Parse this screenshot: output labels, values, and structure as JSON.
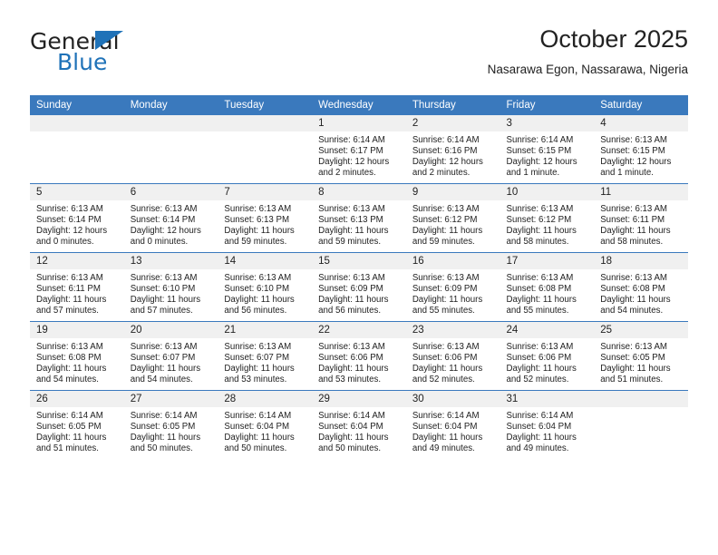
{
  "brand": {
    "name_part1": "General",
    "name_part2": "Blue",
    "triangle_icon": "triangle-icon",
    "accent_color": "#1f72b8"
  },
  "header": {
    "title": "October 2025",
    "subtitle": "Nasarawa Egon, Nassarawa, Nigeria"
  },
  "colors": {
    "header_blue": "#3a79bd",
    "daynum_band": "#f0f0f0",
    "text": "#222222"
  },
  "calendar": {
    "weekday_headers": [
      "Sunday",
      "Monday",
      "Tuesday",
      "Wednesday",
      "Thursday",
      "Friday",
      "Saturday"
    ],
    "weeks": [
      [
        {
          "day": "",
          "lines": []
        },
        {
          "day": "",
          "lines": []
        },
        {
          "day": "",
          "lines": []
        },
        {
          "day": "1",
          "lines": [
            "Sunrise: 6:14 AM",
            "Sunset: 6:17 PM",
            "Daylight: 12 hours",
            "and 2 minutes."
          ]
        },
        {
          "day": "2",
          "lines": [
            "Sunrise: 6:14 AM",
            "Sunset: 6:16 PM",
            "Daylight: 12 hours",
            "and 2 minutes."
          ]
        },
        {
          "day": "3",
          "lines": [
            "Sunrise: 6:14 AM",
            "Sunset: 6:15 PM",
            "Daylight: 12 hours",
            "and 1 minute."
          ]
        },
        {
          "day": "4",
          "lines": [
            "Sunrise: 6:13 AM",
            "Sunset: 6:15 PM",
            "Daylight: 12 hours",
            "and 1 minute."
          ]
        }
      ],
      [
        {
          "day": "5",
          "lines": [
            "Sunrise: 6:13 AM",
            "Sunset: 6:14 PM",
            "Daylight: 12 hours",
            "and 0 minutes."
          ]
        },
        {
          "day": "6",
          "lines": [
            "Sunrise: 6:13 AM",
            "Sunset: 6:14 PM",
            "Daylight: 12 hours",
            "and 0 minutes."
          ]
        },
        {
          "day": "7",
          "lines": [
            "Sunrise: 6:13 AM",
            "Sunset: 6:13 PM",
            "Daylight: 11 hours",
            "and 59 minutes."
          ]
        },
        {
          "day": "8",
          "lines": [
            "Sunrise: 6:13 AM",
            "Sunset: 6:13 PM",
            "Daylight: 11 hours",
            "and 59 minutes."
          ]
        },
        {
          "day": "9",
          "lines": [
            "Sunrise: 6:13 AM",
            "Sunset: 6:12 PM",
            "Daylight: 11 hours",
            "and 59 minutes."
          ]
        },
        {
          "day": "10",
          "lines": [
            "Sunrise: 6:13 AM",
            "Sunset: 6:12 PM",
            "Daylight: 11 hours",
            "and 58 minutes."
          ]
        },
        {
          "day": "11",
          "lines": [
            "Sunrise: 6:13 AM",
            "Sunset: 6:11 PM",
            "Daylight: 11 hours",
            "and 58 minutes."
          ]
        }
      ],
      [
        {
          "day": "12",
          "lines": [
            "Sunrise: 6:13 AM",
            "Sunset: 6:11 PM",
            "Daylight: 11 hours",
            "and 57 minutes."
          ]
        },
        {
          "day": "13",
          "lines": [
            "Sunrise: 6:13 AM",
            "Sunset: 6:10 PM",
            "Daylight: 11 hours",
            "and 57 minutes."
          ]
        },
        {
          "day": "14",
          "lines": [
            "Sunrise: 6:13 AM",
            "Sunset: 6:10 PM",
            "Daylight: 11 hours",
            "and 56 minutes."
          ]
        },
        {
          "day": "15",
          "lines": [
            "Sunrise: 6:13 AM",
            "Sunset: 6:09 PM",
            "Daylight: 11 hours",
            "and 56 minutes."
          ]
        },
        {
          "day": "16",
          "lines": [
            "Sunrise: 6:13 AM",
            "Sunset: 6:09 PM",
            "Daylight: 11 hours",
            "and 55 minutes."
          ]
        },
        {
          "day": "17",
          "lines": [
            "Sunrise: 6:13 AM",
            "Sunset: 6:08 PM",
            "Daylight: 11 hours",
            "and 55 minutes."
          ]
        },
        {
          "day": "18",
          "lines": [
            "Sunrise: 6:13 AM",
            "Sunset: 6:08 PM",
            "Daylight: 11 hours",
            "and 54 minutes."
          ]
        }
      ],
      [
        {
          "day": "19",
          "lines": [
            "Sunrise: 6:13 AM",
            "Sunset: 6:08 PM",
            "Daylight: 11 hours",
            "and 54 minutes."
          ]
        },
        {
          "day": "20",
          "lines": [
            "Sunrise: 6:13 AM",
            "Sunset: 6:07 PM",
            "Daylight: 11 hours",
            "and 54 minutes."
          ]
        },
        {
          "day": "21",
          "lines": [
            "Sunrise: 6:13 AM",
            "Sunset: 6:07 PM",
            "Daylight: 11 hours",
            "and 53 minutes."
          ]
        },
        {
          "day": "22",
          "lines": [
            "Sunrise: 6:13 AM",
            "Sunset: 6:06 PM",
            "Daylight: 11 hours",
            "and 53 minutes."
          ]
        },
        {
          "day": "23",
          "lines": [
            "Sunrise: 6:13 AM",
            "Sunset: 6:06 PM",
            "Daylight: 11 hours",
            "and 52 minutes."
          ]
        },
        {
          "day": "24",
          "lines": [
            "Sunrise: 6:13 AM",
            "Sunset: 6:06 PM",
            "Daylight: 11 hours",
            "and 52 minutes."
          ]
        },
        {
          "day": "25",
          "lines": [
            "Sunrise: 6:13 AM",
            "Sunset: 6:05 PM",
            "Daylight: 11 hours",
            "and 51 minutes."
          ]
        }
      ],
      [
        {
          "day": "26",
          "lines": [
            "Sunrise: 6:14 AM",
            "Sunset: 6:05 PM",
            "Daylight: 11 hours",
            "and 51 minutes."
          ]
        },
        {
          "day": "27",
          "lines": [
            "Sunrise: 6:14 AM",
            "Sunset: 6:05 PM",
            "Daylight: 11 hours",
            "and 50 minutes."
          ]
        },
        {
          "day": "28",
          "lines": [
            "Sunrise: 6:14 AM",
            "Sunset: 6:04 PM",
            "Daylight: 11 hours",
            "and 50 minutes."
          ]
        },
        {
          "day": "29",
          "lines": [
            "Sunrise: 6:14 AM",
            "Sunset: 6:04 PM",
            "Daylight: 11 hours",
            "and 50 minutes."
          ]
        },
        {
          "day": "30",
          "lines": [
            "Sunrise: 6:14 AM",
            "Sunset: 6:04 PM",
            "Daylight: 11 hours",
            "and 49 minutes."
          ]
        },
        {
          "day": "31",
          "lines": [
            "Sunrise: 6:14 AM",
            "Sunset: 6:04 PM",
            "Daylight: 11 hours",
            "and 49 minutes."
          ]
        },
        {
          "day": "",
          "lines": []
        }
      ]
    ]
  }
}
